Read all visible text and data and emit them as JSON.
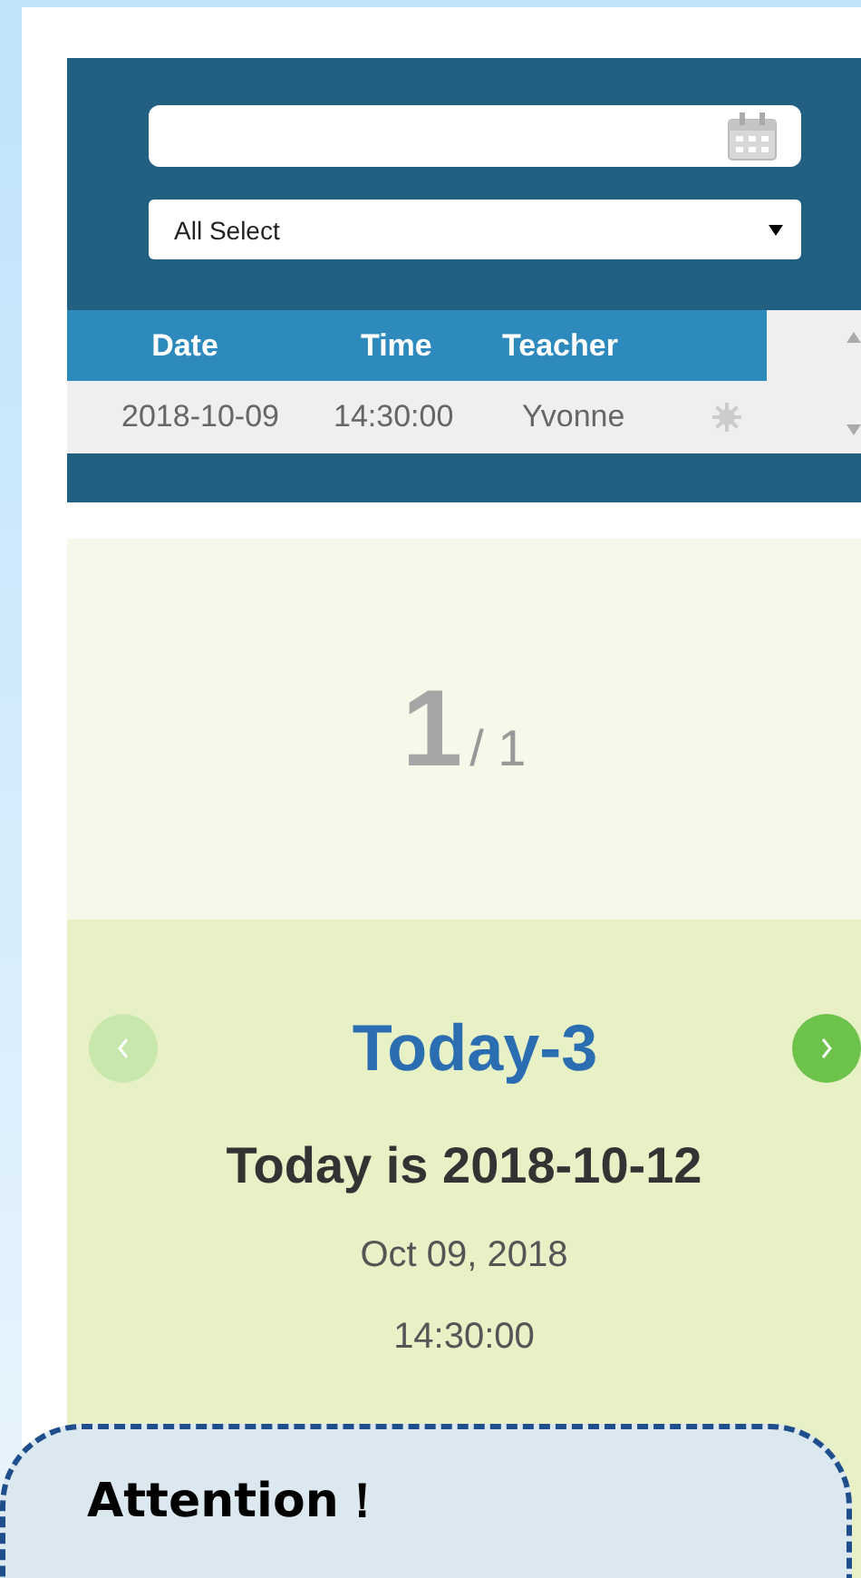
{
  "filter": {
    "select": {
      "value": "All Select"
    }
  },
  "table": {
    "columns": [
      "Date",
      "Time",
      "Teacher"
    ],
    "rows": [
      {
        "date": "2018-10-09",
        "time": "14:30:00",
        "teacher": "Yvonne"
      }
    ]
  },
  "pager": {
    "current": "1",
    "total": "/ 1"
  },
  "detail": {
    "title": "Today-3",
    "prev_disabled": true,
    "next_disabled": false,
    "today": "Today is 2018-10-12",
    "date": "Oct 09, 2018",
    "time": "14:30:00"
  },
  "callout": {
    "title": "Attention！"
  }
}
